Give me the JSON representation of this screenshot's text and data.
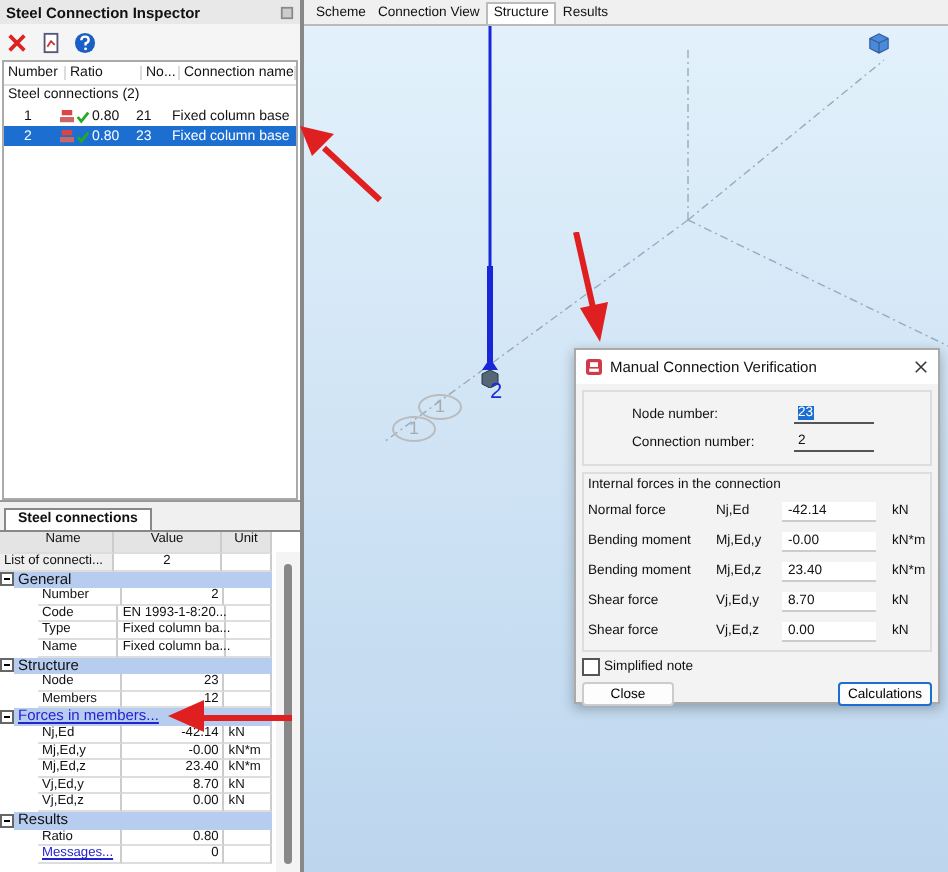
{
  "inspector": {
    "title": "Steel Connection Inspector",
    "columns": [
      "Number",
      "Ratio",
      "No...",
      "Connection name"
    ],
    "group": "Steel connections (2)",
    "rows": [
      {
        "number": "1",
        "ratio": "0.80",
        "node": "21",
        "name": "Fixed column base",
        "selected": false
      },
      {
        "number": "2",
        "ratio": "0.80",
        "node": "23",
        "name": "Fixed column base",
        "selected": true
      }
    ]
  },
  "panel_tab": "Steel connections",
  "properties": {
    "columns": [
      "Name",
      "Value",
      "Unit"
    ],
    "rows": [
      {
        "kind": "top",
        "name": "List of connecti...",
        "value": "2"
      },
      {
        "kind": "group",
        "name": "General"
      },
      {
        "kind": "row",
        "name": "Number",
        "value": "2"
      },
      {
        "kind": "text",
        "name": "Code",
        "value": "EN 1993-1-8:20..."
      },
      {
        "kind": "text",
        "name": "Type",
        "value": "Fixed column ba..."
      },
      {
        "kind": "text",
        "name": "Name",
        "value": "Fixed column ba..."
      },
      {
        "kind": "group",
        "name": "Structure"
      },
      {
        "kind": "row",
        "name": "Node",
        "value": "23"
      },
      {
        "kind": "row",
        "name": "Members",
        "value": "12"
      },
      {
        "kind": "group",
        "name": "Forces in members...",
        "link": true
      },
      {
        "kind": "row",
        "name": "Nj,Ed",
        "value": "-42.14",
        "unit": "kN"
      },
      {
        "kind": "row",
        "name": "Mj,Ed,y",
        "value": "-0.00",
        "unit": "kN*m"
      },
      {
        "kind": "row",
        "name": "Mj,Ed,z",
        "value": "23.40",
        "unit": "kN*m"
      },
      {
        "kind": "row",
        "name": "Vj,Ed,y",
        "value": "8.70",
        "unit": "kN"
      },
      {
        "kind": "row",
        "name": "Vj,Ed,z",
        "value": "0.00",
        "unit": "kN"
      },
      {
        "kind": "group",
        "name": "Results"
      },
      {
        "kind": "row",
        "name": "Ratio",
        "value": "0.80"
      },
      {
        "kind": "row",
        "name": "Messages...",
        "value": "0",
        "link": true
      }
    ]
  },
  "view_tabs": [
    {
      "label": "Scheme",
      "selected": false
    },
    {
      "label": "Connection View",
      "selected": false
    },
    {
      "label": "Structure",
      "selected": true
    },
    {
      "label": "Results",
      "selected": false
    }
  ],
  "viewport": {
    "node_label": "2",
    "member_labels": [
      "1",
      "1"
    ]
  },
  "dialog": {
    "title": "Manual Connection Verification",
    "node_label": "Node number:",
    "node_value": "23",
    "connection_label": "Connection number:",
    "connection_value": "2",
    "section": "Internal forces in the connection",
    "forces": [
      {
        "name": "Normal force",
        "symbol": "Nj,Ed",
        "value": "-42.14",
        "unit": "kN"
      },
      {
        "name": "Bending moment",
        "symbol": "Mj,Ed,y",
        "value": "-0.00",
        "unit": "kN*m"
      },
      {
        "name": "Bending moment",
        "symbol": "Mj,Ed,z",
        "value": "23.40",
        "unit": "kN*m"
      },
      {
        "name": "Shear force",
        "symbol": "Vj,Ed,y",
        "value": "8.70",
        "unit": "kN"
      },
      {
        "name": "Shear force",
        "symbol": "Vj,Ed,z",
        "value": "0.00",
        "unit": "kN"
      }
    ],
    "simplified_note": {
      "label": "Simplified note",
      "checked": false
    },
    "buttons": [
      "Close",
      "Calculations"
    ]
  }
}
